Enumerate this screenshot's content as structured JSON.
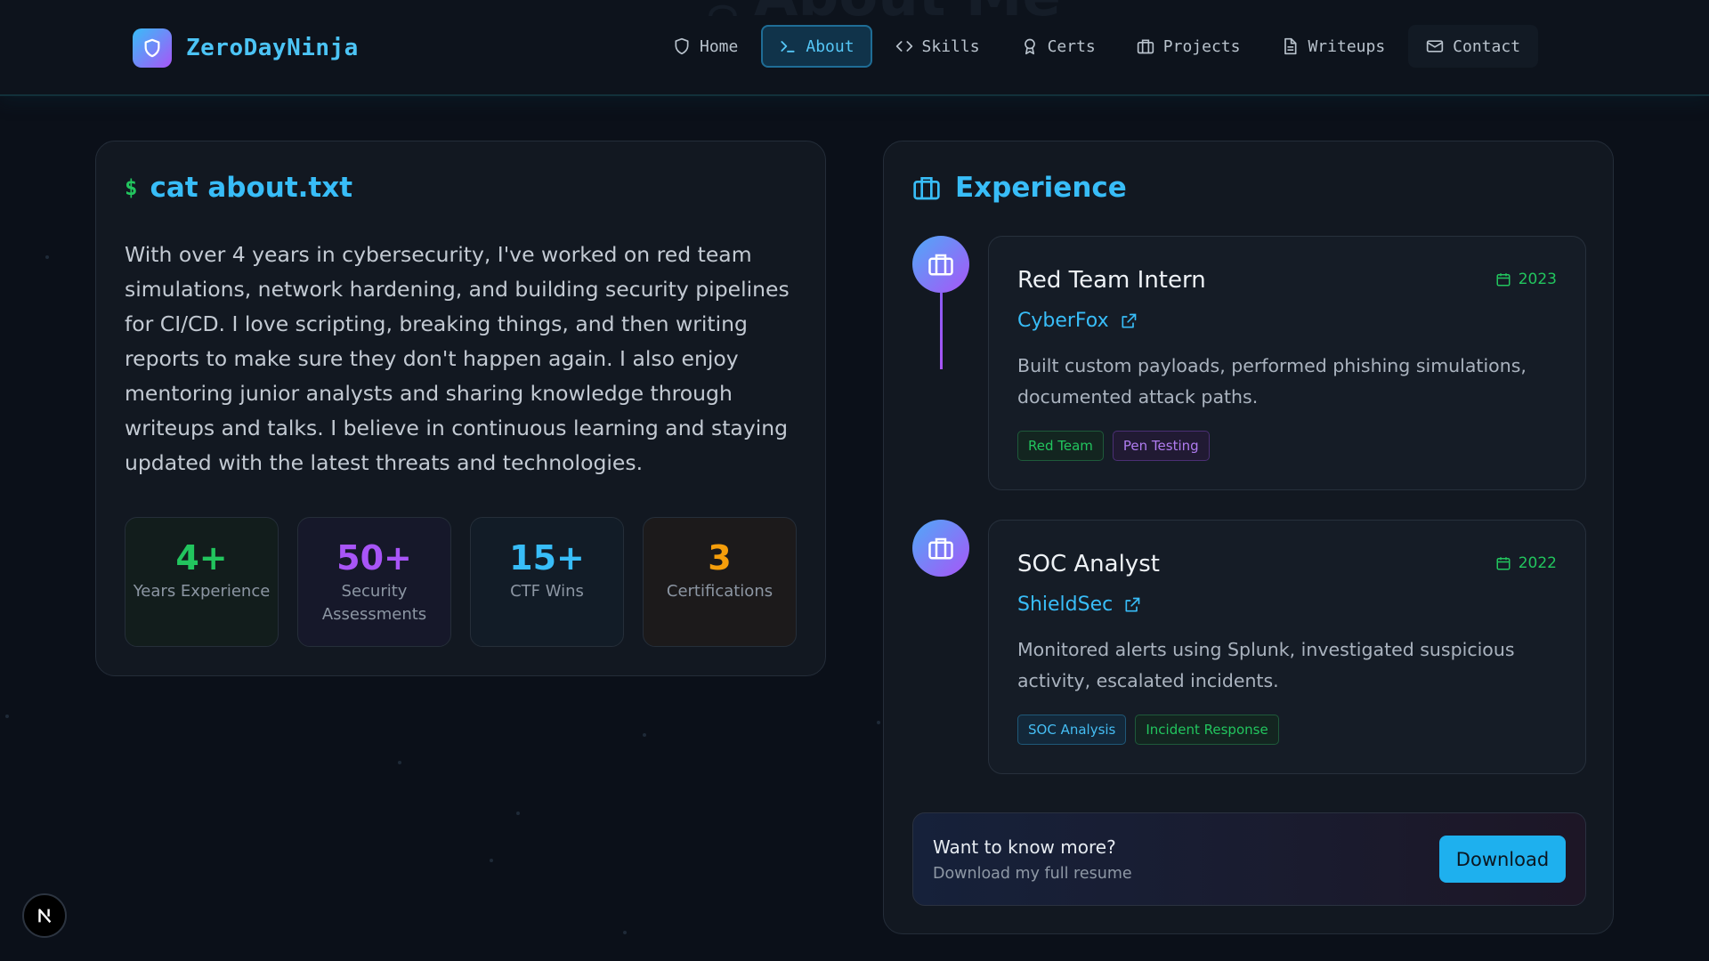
{
  "brand": {
    "name": "ZeroDayNinja",
    "logo_icon": "shield-icon"
  },
  "header": {
    "ghost_title": "About Me"
  },
  "nav": {
    "items": [
      {
        "label": "Home",
        "icon": "shield-icon"
      },
      {
        "label": "About",
        "icon": "terminal-icon",
        "active": true
      },
      {
        "label": "Skills",
        "icon": "code-icon"
      },
      {
        "label": "Certs",
        "icon": "award-icon"
      },
      {
        "label": "Projects",
        "icon": "briefcase-icon"
      },
      {
        "label": "Writeups",
        "icon": "document-icon"
      },
      {
        "label": "Contact",
        "icon": "mail-icon"
      }
    ]
  },
  "about": {
    "prompt": "$",
    "command": "cat about.txt",
    "text": "With over 4 years in cybersecurity, I've worked on red team simulations, network hardening, and building security pipelines for CI/CD. I love scripting, breaking things, and then writing reports to make sure they don't happen again. I also enjoy mentoring junior analysts and sharing knowledge through writeups and talks. I believe in continuous learning and staying updated with the latest threats and technologies.",
    "stats": [
      {
        "value": "4+",
        "label": "Years Experience",
        "color": "#22c55e"
      },
      {
        "value": "50+",
        "label": "Security Assessments",
        "color": "#a855f7"
      },
      {
        "value": "15+",
        "label": "CTF Wins",
        "color": "#38bdf8"
      },
      {
        "value": "3",
        "label": "Certifications",
        "color": "#f59e0b"
      }
    ]
  },
  "experience": {
    "heading": "Experience",
    "jobs": [
      {
        "title": "Red Team Intern",
        "year": "2023",
        "company": "CyberFox",
        "description": "Built custom payloads, performed phishing simulations, documented attack paths.",
        "tags": [
          "Red Team",
          "Pen Testing"
        ]
      },
      {
        "title": "SOC Analyst",
        "year": "2022",
        "company": "ShieldSec",
        "description": "Monitored alerts using Splunk, investigated suspicious activity, escalated incidents.",
        "tags": [
          "SOC Analysis",
          "Incident Response"
        ]
      }
    ],
    "cta": {
      "title": "Want to know more?",
      "subtitle": "Download my full resume",
      "button": "Download"
    }
  },
  "colors": {
    "accent": "#38bdf8",
    "green": "#22c55e",
    "purple": "#a855f7",
    "orange": "#f59e0b",
    "background": "#0b1019"
  }
}
